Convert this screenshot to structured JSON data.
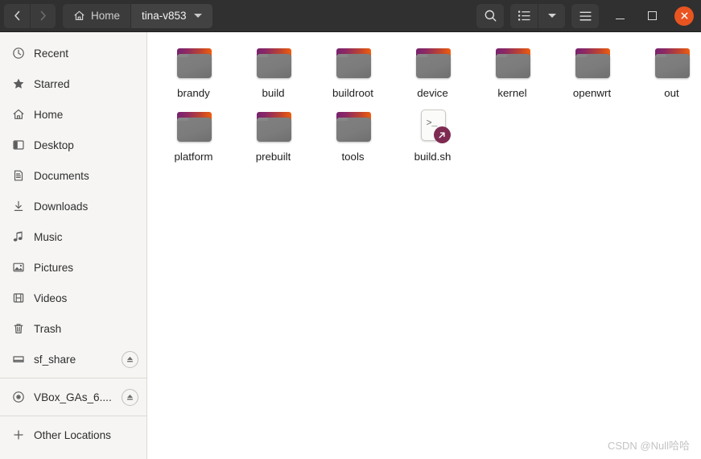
{
  "window": {
    "title": "tina-v853",
    "nav": {
      "back_label": "Back",
      "forward_label": "Forward"
    },
    "breadcrumbs": [
      {
        "label": "Home",
        "icon": "home-icon",
        "current": false
      },
      {
        "label": "tina-v853",
        "icon": "",
        "current": true
      }
    ],
    "toolbar": {
      "search_label": "Search",
      "view_list_label": "List view",
      "view_options_label": "View options",
      "menu_label": "Main menu"
    },
    "controls": {
      "minimize_label": "Minimize",
      "maximize_label": "Maximize",
      "close_label": "Close",
      "close_color": "#e95420"
    },
    "header_bg": "#303030"
  },
  "sidebar": {
    "items": [
      {
        "label": "Recent",
        "icon": "clock-icon",
        "eject": false
      },
      {
        "label": "Starred",
        "icon": "star-icon",
        "eject": false
      },
      {
        "label": "Home",
        "icon": "home-icon",
        "eject": false
      },
      {
        "label": "Desktop",
        "icon": "desktop-icon",
        "eject": false
      },
      {
        "label": "Documents",
        "icon": "document-icon",
        "eject": false
      },
      {
        "label": "Downloads",
        "icon": "download-icon",
        "eject": false
      },
      {
        "label": "Music",
        "icon": "music-icon",
        "eject": false
      },
      {
        "label": "Pictures",
        "icon": "picture-icon",
        "eject": false
      },
      {
        "label": "Videos",
        "icon": "video-icon",
        "eject": false
      },
      {
        "label": "Trash",
        "icon": "trash-icon",
        "eject": false
      },
      {
        "label": "sf_share",
        "icon": "drive-icon",
        "eject": true
      },
      {
        "label": "VBox_GAs_6....",
        "icon": "disc-icon",
        "eject": true
      },
      {
        "label": "Other Locations",
        "icon": "plus-icon",
        "eject": false
      }
    ],
    "separator_after": [
      10,
      11
    ],
    "bg": "#f6f5f4"
  },
  "files": [
    {
      "name": "brandy",
      "type": "folder"
    },
    {
      "name": "build",
      "type": "folder"
    },
    {
      "name": "buildroot",
      "type": "folder"
    },
    {
      "name": "device",
      "type": "folder"
    },
    {
      "name": "kernel",
      "type": "folder"
    },
    {
      "name": "openwrt",
      "type": "folder"
    },
    {
      "name": "out",
      "type": "folder"
    },
    {
      "name": "platform",
      "type": "folder"
    },
    {
      "name": "prebuilt",
      "type": "folder"
    },
    {
      "name": "tools",
      "type": "folder"
    },
    {
      "name": "build.sh",
      "type": "script-symlink"
    }
  ],
  "watermark": "CSDN @Null哈哈"
}
